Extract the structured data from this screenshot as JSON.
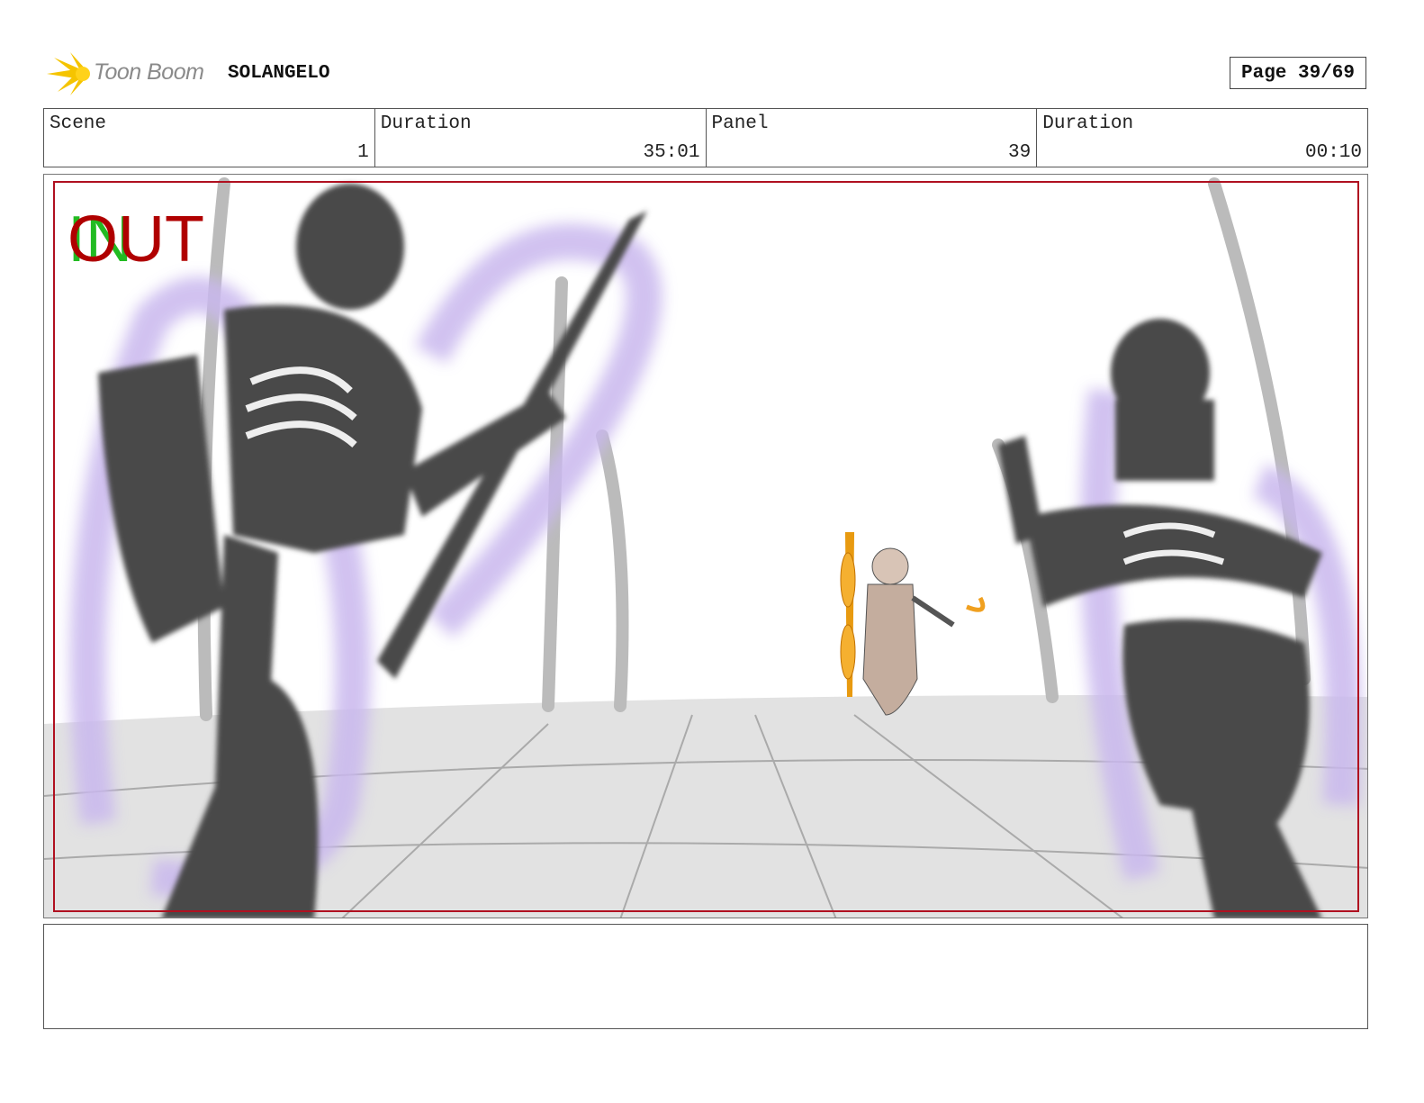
{
  "header": {
    "logo_text": "Toon Boom",
    "project": "SOLANGELO",
    "page": "Page 39/69"
  },
  "info": [
    {
      "label": "Scene",
      "value": "1"
    },
    {
      "label": "Duration",
      "value": "35:01"
    },
    {
      "label": "Panel",
      "value": "39"
    },
    {
      "label": "Duration",
      "value": "00:10"
    }
  ],
  "panel": {
    "in_marker": "IN",
    "out_marker": "OUT",
    "colors": {
      "safe_frame": "#b01020",
      "in": "#22bb22",
      "out": "#b00000",
      "magic": "#c9b8ee",
      "skeleton": "#4a4a4a"
    }
  },
  "caption": {
    "text": ""
  }
}
